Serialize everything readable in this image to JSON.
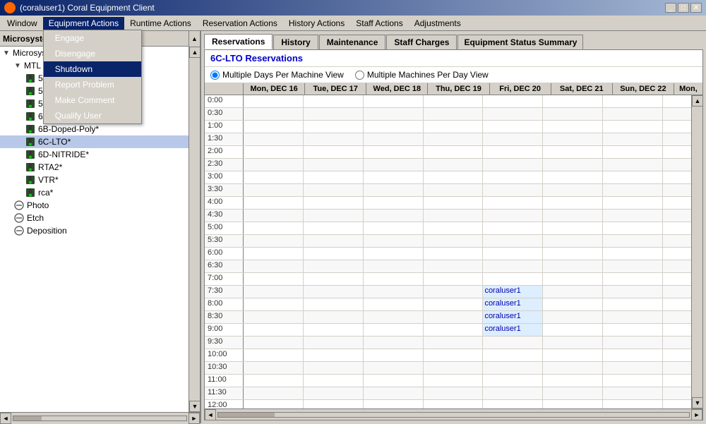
{
  "window": {
    "title": "(coraluser1) Coral Equipment Client",
    "icon": "coral-icon"
  },
  "menubar": {
    "items": [
      {
        "label": "Window",
        "id": "window"
      },
      {
        "label": "Equipment Actions",
        "id": "equipment-actions",
        "active": true
      },
      {
        "label": "Runtime Actions",
        "id": "runtime-actions"
      },
      {
        "label": "Reservation Actions",
        "id": "reservation-actions"
      },
      {
        "label": "History Actions",
        "id": "history-actions"
      },
      {
        "label": "Staff Actions",
        "id": "staff-actions"
      },
      {
        "label": "Adjustments",
        "id": "adjustments"
      }
    ],
    "dropdown": {
      "items": [
        {
          "label": "Engage",
          "id": "engage"
        },
        {
          "label": "Disengage",
          "id": "disengage"
        },
        {
          "label": "Shutdown",
          "id": "shutdown",
          "highlighted": true
        },
        {
          "label": "Report Problem",
          "id": "report-problem"
        },
        {
          "label": "Make Comment",
          "id": "make-comment"
        },
        {
          "label": "Qualify User",
          "id": "qualify-user"
        }
      ]
    }
  },
  "sidebar": {
    "header": "Microsystems Laboratories",
    "tree": [
      {
        "label": "MTL",
        "indent": 0,
        "type": "expand",
        "id": "mtl"
      },
      {
        "label": "MTL",
        "indent": 1,
        "type": "expand",
        "id": "mtl-sub"
      },
      {
        "label": "5B-ANNEAL*",
        "indent": 2,
        "type": "traffic",
        "id": "5b-anneal"
      },
      {
        "label": "5C-Thick-Oxide",
        "indent": 2,
        "type": "traffic",
        "id": "5c-thick-oxide"
      },
      {
        "label": "5D-CMOS-FieldOx",
        "indent": 2,
        "type": "traffic",
        "id": "5d-cmos-fieldox"
      },
      {
        "label": "6A-CMOS-Poly*",
        "indent": 2,
        "type": "traffic",
        "id": "6a-cmos-poly"
      },
      {
        "label": "6B-Doped-Poly*",
        "indent": 2,
        "type": "traffic",
        "id": "6b-doped-poly"
      },
      {
        "label": "6C-LTO*",
        "indent": 2,
        "type": "traffic",
        "id": "6c-lto",
        "selected": true
      },
      {
        "label": "6D-NITRIDE*",
        "indent": 2,
        "type": "traffic",
        "id": "6d-nitride"
      },
      {
        "label": "RTA2*",
        "indent": 2,
        "type": "traffic",
        "id": "rta2"
      },
      {
        "label": "VTR*",
        "indent": 2,
        "type": "traffic",
        "id": "vtr"
      },
      {
        "label": "rca*",
        "indent": 2,
        "type": "traffic",
        "id": "rca"
      },
      {
        "label": "Photo",
        "indent": 1,
        "type": "circle-minus",
        "id": "photo"
      },
      {
        "label": "Etch",
        "indent": 1,
        "type": "circle-minus",
        "id": "etch"
      },
      {
        "label": "Deposition",
        "indent": 1,
        "type": "circle-minus",
        "id": "deposition"
      }
    ]
  },
  "tabs": [
    {
      "label": "Reservations",
      "id": "reservations",
      "active": true
    },
    {
      "label": "History",
      "id": "history"
    },
    {
      "label": "Maintenance",
      "id": "maintenance"
    },
    {
      "label": "Staff Charges",
      "id": "staff-charges"
    },
    {
      "label": "Equipment Status Summary",
      "id": "equipment-status-summary"
    }
  ],
  "content": {
    "title": "6C-LTO Reservations",
    "radio_view_1": "Multiple Days Per Machine View",
    "radio_view_2": "Multiple Machines Per Day View",
    "selected_view": "view1",
    "calendar": {
      "days": [
        "Mon, DEC 16",
        "Tue, DEC 17",
        "Wed, DEC 18",
        "Thu, DEC 19",
        "Fri, DEC 20",
        "Sat, DEC 21",
        "Sun, DEC 22",
        "Mon,"
      ],
      "times": [
        "0:00",
        "0:30",
        "1:00",
        "1:30",
        "2:00",
        "2:30",
        "3:00",
        "3:30",
        "4:00",
        "4:30",
        "5:00",
        "5:30",
        "6:00",
        "6:30",
        "7:00",
        "7:30",
        "8:00",
        "8:30",
        "9:00",
        "9:30",
        "10:00",
        "10:30",
        "11:00",
        "11:30",
        "12:00"
      ],
      "entries": [
        {
          "time": "7:30",
          "day_index": 4,
          "label": "coraluser1"
        },
        {
          "time": "8:00",
          "day_index": 4,
          "label": "coraluser1"
        },
        {
          "time": "8:30",
          "day_index": 4,
          "label": "coraluser1"
        },
        {
          "time": "9:00",
          "day_index": 4,
          "label": "coraluser1"
        }
      ]
    }
  }
}
